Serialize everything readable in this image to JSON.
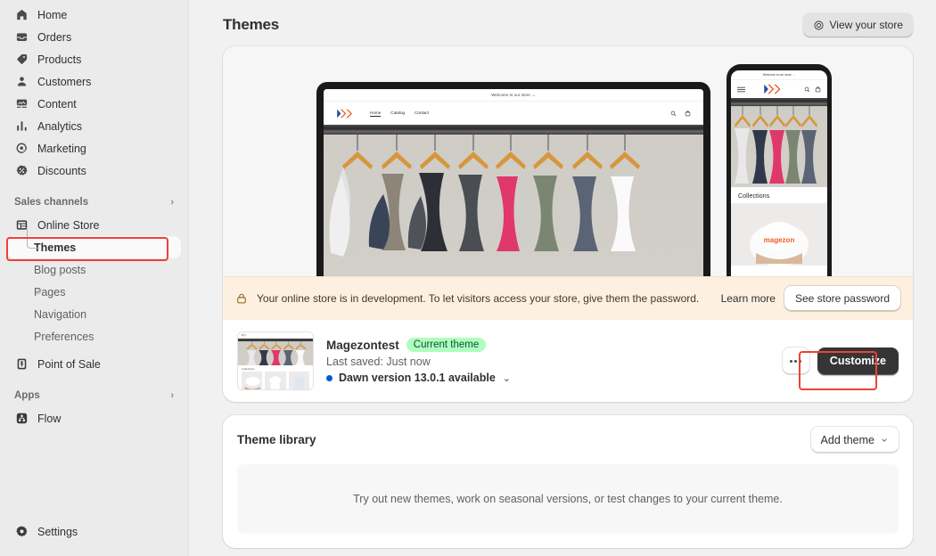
{
  "sidebar": {
    "primary_items": [
      {
        "label": "Home",
        "icon": "home-icon"
      },
      {
        "label": "Orders",
        "icon": "orders-icon"
      },
      {
        "label": "Products",
        "icon": "products-tag-icon"
      },
      {
        "label": "Customers",
        "icon": "customers-person-icon"
      },
      {
        "label": "Content",
        "icon": "content-image-icon"
      },
      {
        "label": "Analytics",
        "icon": "analytics-bars-icon"
      },
      {
        "label": "Marketing",
        "icon": "marketing-target-icon"
      },
      {
        "label": "Discounts",
        "icon": "discounts-percent-icon"
      }
    ],
    "sales_channels": {
      "heading": "Sales channels",
      "expand_icon": "chevron-right-icon",
      "online_store": {
        "label": "Online Store",
        "icon": "online-store-icon"
      },
      "sub_items": [
        {
          "label": "Themes",
          "active": true
        },
        {
          "label": "Blog posts",
          "active": false
        },
        {
          "label": "Pages",
          "active": false
        },
        {
          "label": "Navigation",
          "active": false
        },
        {
          "label": "Preferences",
          "active": false
        }
      ],
      "point_of_sale": {
        "label": "Point of Sale",
        "icon": "point-of-sale-icon"
      }
    },
    "apps": {
      "heading": "Apps",
      "expand_icon": "chevron-right-icon",
      "items": [
        {
          "label": "Flow",
          "icon": "flow-app-icon"
        }
      ]
    },
    "settings": {
      "label": "Settings",
      "icon": "gear-icon"
    }
  },
  "header": {
    "title": "Themes",
    "view_store_button": {
      "label": "View your store",
      "icon": "eye-icon"
    }
  },
  "preview": {
    "desktop": {
      "announcement": "Welcome to our store  →",
      "logo": "magezon-chevrons-logo",
      "nav": [
        "Home",
        "Catalog",
        "Contact"
      ],
      "icons": [
        "search-icon",
        "cart-icon"
      ]
    },
    "mobile": {
      "announcement": "Welcome to our store  →",
      "menu_icon": "hamburger-menu-icon",
      "logo": "magezon-chevrons-logo",
      "icons": [
        "search-icon",
        "cart-icon"
      ],
      "section_title": "Collections",
      "product_label": "magezon"
    }
  },
  "dev_banner": {
    "icon": "lock-icon",
    "message": "Your online store is in development. To let visitors access your store, give them the password.",
    "learn_more": "Learn more",
    "button": "See store password"
  },
  "theme": {
    "name": "Magezontest",
    "badge": "Current theme",
    "last_saved": "Last saved: Just now",
    "version_notice": "Dawn version 13.0.1 available",
    "version_chevron": "chevron-down-icon",
    "more_button": "more-actions-ellipsis",
    "customize_button": "Customize"
  },
  "theme_library": {
    "title": "Theme library",
    "add_button": "Add theme",
    "add_button_chevron": "chevron-down-icon",
    "empty_text": "Try out new themes, work on seasonal versions, or test changes to your current theme."
  },
  "colors": {
    "accent_blue": "#005bd3",
    "badge_bg": "#affebf",
    "badge_text": "#0c5132",
    "banner_bg": "#fdf0e1",
    "annotation_red": "#ef4036",
    "customize_bg": "#353535",
    "sidebar_bg": "#ebebeb",
    "page_bg": "#f1f1f1"
  }
}
